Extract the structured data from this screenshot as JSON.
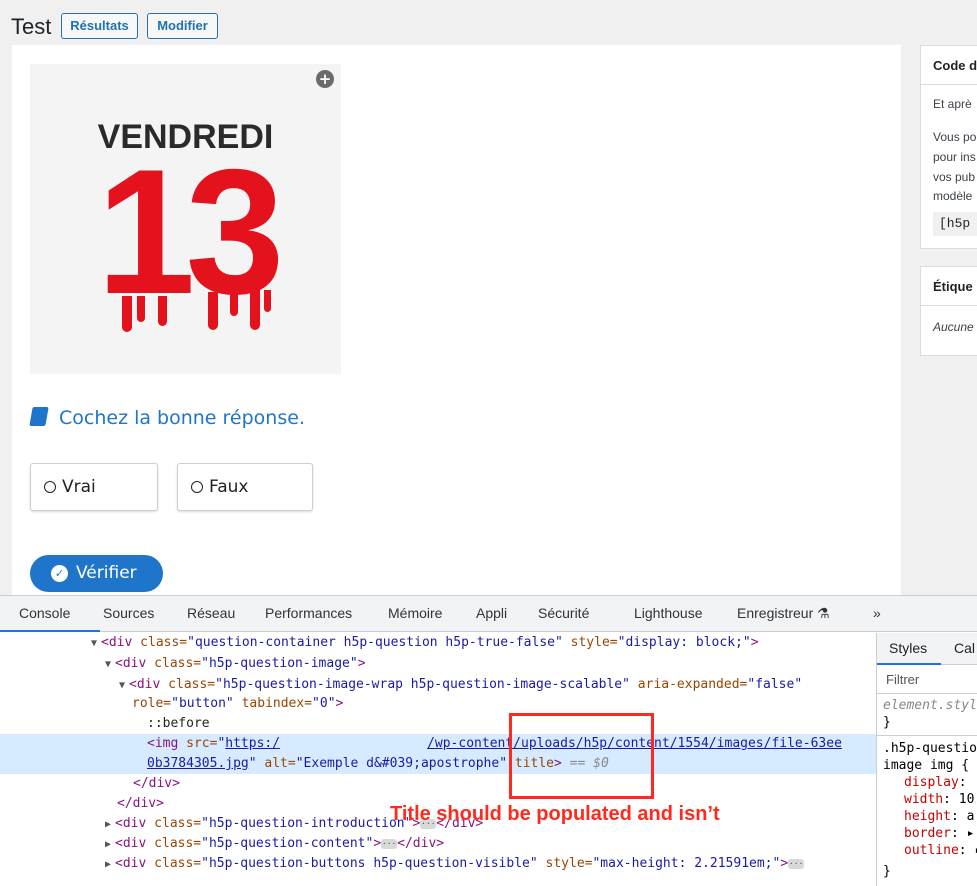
{
  "wp": {
    "page_title": "Test",
    "results_label": "Résultats",
    "edit_label": "Modifier"
  },
  "h5p": {
    "image_text_line1": "VENDREDI",
    "image_text_number": "13",
    "question": "Cochez la bonne réponse.",
    "answers": [
      "Vrai",
      "Faux"
    ],
    "check_label": "Vérifier",
    "accent_color": "#1f75c9"
  },
  "sidebar": {
    "box1_title": "Code d",
    "box1_line1": "Et aprè",
    "box1_line2": "Vous po",
    "box1_line3": "pour ins",
    "box1_line4": "vos pub",
    "box1_line5": "modèle",
    "box1_shortcode": "[h5p",
    "box2_title": "Étique",
    "box2_text": "Aucune"
  },
  "devtools": {
    "tabs": [
      "Console",
      "Sources",
      "Réseau",
      "Performances",
      "Mémoire",
      "Appli",
      "Sécurité",
      "Lighthouse",
      "Enregistreur ⚗",
      "»"
    ],
    "styles_tabs": [
      "Styles",
      "Cal"
    ],
    "filter_placeholder": "Filtrer",
    "dom": {
      "l1_tag": "<div",
      "l1_attr1": " class=",
      "l1_val1": "\"question-container h5p-question h5p-true-false\"",
      "l1_attr2": " style=",
      "l1_val2": "\"display: block;\"",
      "l1_end": ">",
      "l2_tag": "<div",
      "l2_attr": " class=",
      "l2_val": "\"h5p-question-image\"",
      "l2_end": ">",
      "l3_tag": "<div",
      "l3_attr1": " class=",
      "l3_val1": "\"h5p-question-image-wrap h5p-question-image-scalable\"",
      "l3_attr2": " aria-expanded=",
      "l3_val2": "\"false\"",
      "l4_attr1": "role=",
      "l4_val1": "\"button\"",
      "l4_attr2": " tabindex=",
      "l4_val2": "\"0\"",
      "l4_end": ">",
      "l5": "::before",
      "l6_tag": "<img",
      "l6_attr": " src=",
      "l6_quote": "\"",
      "l6_link1": "https:/",
      "l6_link2": "/wp-content/uploads/h5p/content/1554/images/file-63ee",
      "l7_link": "0b3784305.jpg",
      "l7_quote": "\"",
      "l7_attr1": " alt=",
      "l7_val1": "\"Exemple d&#039;apostrophe\"",
      "l7_attr2": " title",
      "l7_end": ">",
      "l7_eq": " == $0",
      "l8": "</div>",
      "l9": "</div>",
      "l10_tag": "<div",
      "l10_attr": " class=",
      "l10_val": "\"h5p-question-introduction\"",
      "l10_end": ">",
      "l10_close": "</div>",
      "l11_tag": "<div",
      "l11_attr": " class=",
      "l11_val": "\"h5p-question-content\"",
      "l11_end": ">",
      "l11_close": "</div>",
      "l12_tag": "<div",
      "l12_attr1": " class=",
      "l12_val1": "\"h5p-question-buttons h5p-question-visible\"",
      "l12_attr2": " style=",
      "l12_val2": "\"max-height: 2.21591em;\"",
      "l12_end": ">",
      "ellipsis": "···"
    },
    "styles": {
      "rule1": "element.styl",
      "rule1_close": "}",
      "rule2_sel1": ".h5p-questio",
      "rule2_sel2": "image img {",
      "p1": "display",
      "p2": "width",
      "p2v": " 10",
      "p3": "height",
      "p3v": " a",
      "p4": "border",
      "p4v": " ▸",
      "p5": "outline",
      "p5v": " ▸",
      "rule2_close": "}"
    }
  },
  "annotation": {
    "text": "Title should be populated and isn’t",
    "color": "#ff2a1f"
  }
}
